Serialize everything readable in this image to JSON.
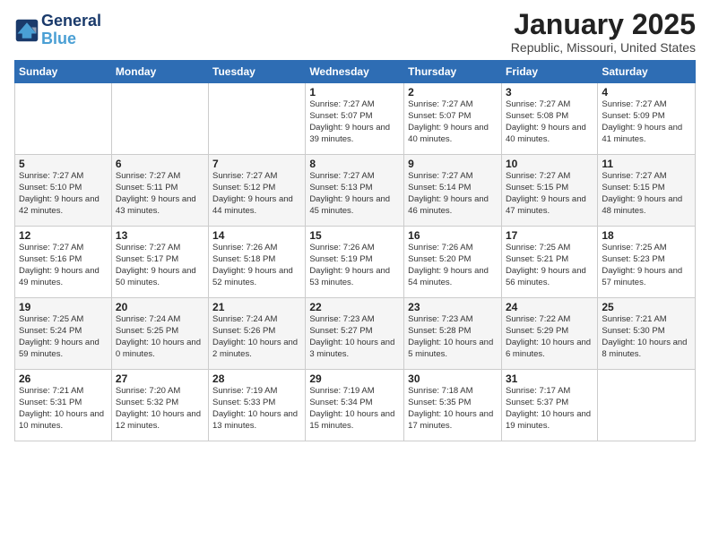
{
  "header": {
    "logo_line1": "General",
    "logo_line2": "Blue",
    "month": "January 2025",
    "location": "Republic, Missouri, United States"
  },
  "weekdays": [
    "Sunday",
    "Monday",
    "Tuesday",
    "Wednesday",
    "Thursday",
    "Friday",
    "Saturday"
  ],
  "weeks": [
    [
      {
        "day": "",
        "info": ""
      },
      {
        "day": "",
        "info": ""
      },
      {
        "day": "",
        "info": ""
      },
      {
        "day": "1",
        "info": "Sunrise: 7:27 AM\nSunset: 5:07 PM\nDaylight: 9 hours\nand 39 minutes."
      },
      {
        "day": "2",
        "info": "Sunrise: 7:27 AM\nSunset: 5:07 PM\nDaylight: 9 hours\nand 40 minutes."
      },
      {
        "day": "3",
        "info": "Sunrise: 7:27 AM\nSunset: 5:08 PM\nDaylight: 9 hours\nand 40 minutes."
      },
      {
        "day": "4",
        "info": "Sunrise: 7:27 AM\nSunset: 5:09 PM\nDaylight: 9 hours\nand 41 minutes."
      }
    ],
    [
      {
        "day": "5",
        "info": "Sunrise: 7:27 AM\nSunset: 5:10 PM\nDaylight: 9 hours\nand 42 minutes."
      },
      {
        "day": "6",
        "info": "Sunrise: 7:27 AM\nSunset: 5:11 PM\nDaylight: 9 hours\nand 43 minutes."
      },
      {
        "day": "7",
        "info": "Sunrise: 7:27 AM\nSunset: 5:12 PM\nDaylight: 9 hours\nand 44 minutes."
      },
      {
        "day": "8",
        "info": "Sunrise: 7:27 AM\nSunset: 5:13 PM\nDaylight: 9 hours\nand 45 minutes."
      },
      {
        "day": "9",
        "info": "Sunrise: 7:27 AM\nSunset: 5:14 PM\nDaylight: 9 hours\nand 46 minutes."
      },
      {
        "day": "10",
        "info": "Sunrise: 7:27 AM\nSunset: 5:15 PM\nDaylight: 9 hours\nand 47 minutes."
      },
      {
        "day": "11",
        "info": "Sunrise: 7:27 AM\nSunset: 5:15 PM\nDaylight: 9 hours\nand 48 minutes."
      }
    ],
    [
      {
        "day": "12",
        "info": "Sunrise: 7:27 AM\nSunset: 5:16 PM\nDaylight: 9 hours\nand 49 minutes."
      },
      {
        "day": "13",
        "info": "Sunrise: 7:27 AM\nSunset: 5:17 PM\nDaylight: 9 hours\nand 50 minutes."
      },
      {
        "day": "14",
        "info": "Sunrise: 7:26 AM\nSunset: 5:18 PM\nDaylight: 9 hours\nand 52 minutes."
      },
      {
        "day": "15",
        "info": "Sunrise: 7:26 AM\nSunset: 5:19 PM\nDaylight: 9 hours\nand 53 minutes."
      },
      {
        "day": "16",
        "info": "Sunrise: 7:26 AM\nSunset: 5:20 PM\nDaylight: 9 hours\nand 54 minutes."
      },
      {
        "day": "17",
        "info": "Sunrise: 7:25 AM\nSunset: 5:21 PM\nDaylight: 9 hours\nand 56 minutes."
      },
      {
        "day": "18",
        "info": "Sunrise: 7:25 AM\nSunset: 5:23 PM\nDaylight: 9 hours\nand 57 minutes."
      }
    ],
    [
      {
        "day": "19",
        "info": "Sunrise: 7:25 AM\nSunset: 5:24 PM\nDaylight: 9 hours\nand 59 minutes."
      },
      {
        "day": "20",
        "info": "Sunrise: 7:24 AM\nSunset: 5:25 PM\nDaylight: 10 hours\nand 0 minutes."
      },
      {
        "day": "21",
        "info": "Sunrise: 7:24 AM\nSunset: 5:26 PM\nDaylight: 10 hours\nand 2 minutes."
      },
      {
        "day": "22",
        "info": "Sunrise: 7:23 AM\nSunset: 5:27 PM\nDaylight: 10 hours\nand 3 minutes."
      },
      {
        "day": "23",
        "info": "Sunrise: 7:23 AM\nSunset: 5:28 PM\nDaylight: 10 hours\nand 5 minutes."
      },
      {
        "day": "24",
        "info": "Sunrise: 7:22 AM\nSunset: 5:29 PM\nDaylight: 10 hours\nand 6 minutes."
      },
      {
        "day": "25",
        "info": "Sunrise: 7:21 AM\nSunset: 5:30 PM\nDaylight: 10 hours\nand 8 minutes."
      }
    ],
    [
      {
        "day": "26",
        "info": "Sunrise: 7:21 AM\nSunset: 5:31 PM\nDaylight: 10 hours\nand 10 minutes."
      },
      {
        "day": "27",
        "info": "Sunrise: 7:20 AM\nSunset: 5:32 PM\nDaylight: 10 hours\nand 12 minutes."
      },
      {
        "day": "28",
        "info": "Sunrise: 7:19 AM\nSunset: 5:33 PM\nDaylight: 10 hours\nand 13 minutes."
      },
      {
        "day": "29",
        "info": "Sunrise: 7:19 AM\nSunset: 5:34 PM\nDaylight: 10 hours\nand 15 minutes."
      },
      {
        "day": "30",
        "info": "Sunrise: 7:18 AM\nSunset: 5:35 PM\nDaylight: 10 hours\nand 17 minutes."
      },
      {
        "day": "31",
        "info": "Sunrise: 7:17 AM\nSunset: 5:37 PM\nDaylight: 10 hours\nand 19 minutes."
      },
      {
        "day": "",
        "info": ""
      }
    ]
  ]
}
